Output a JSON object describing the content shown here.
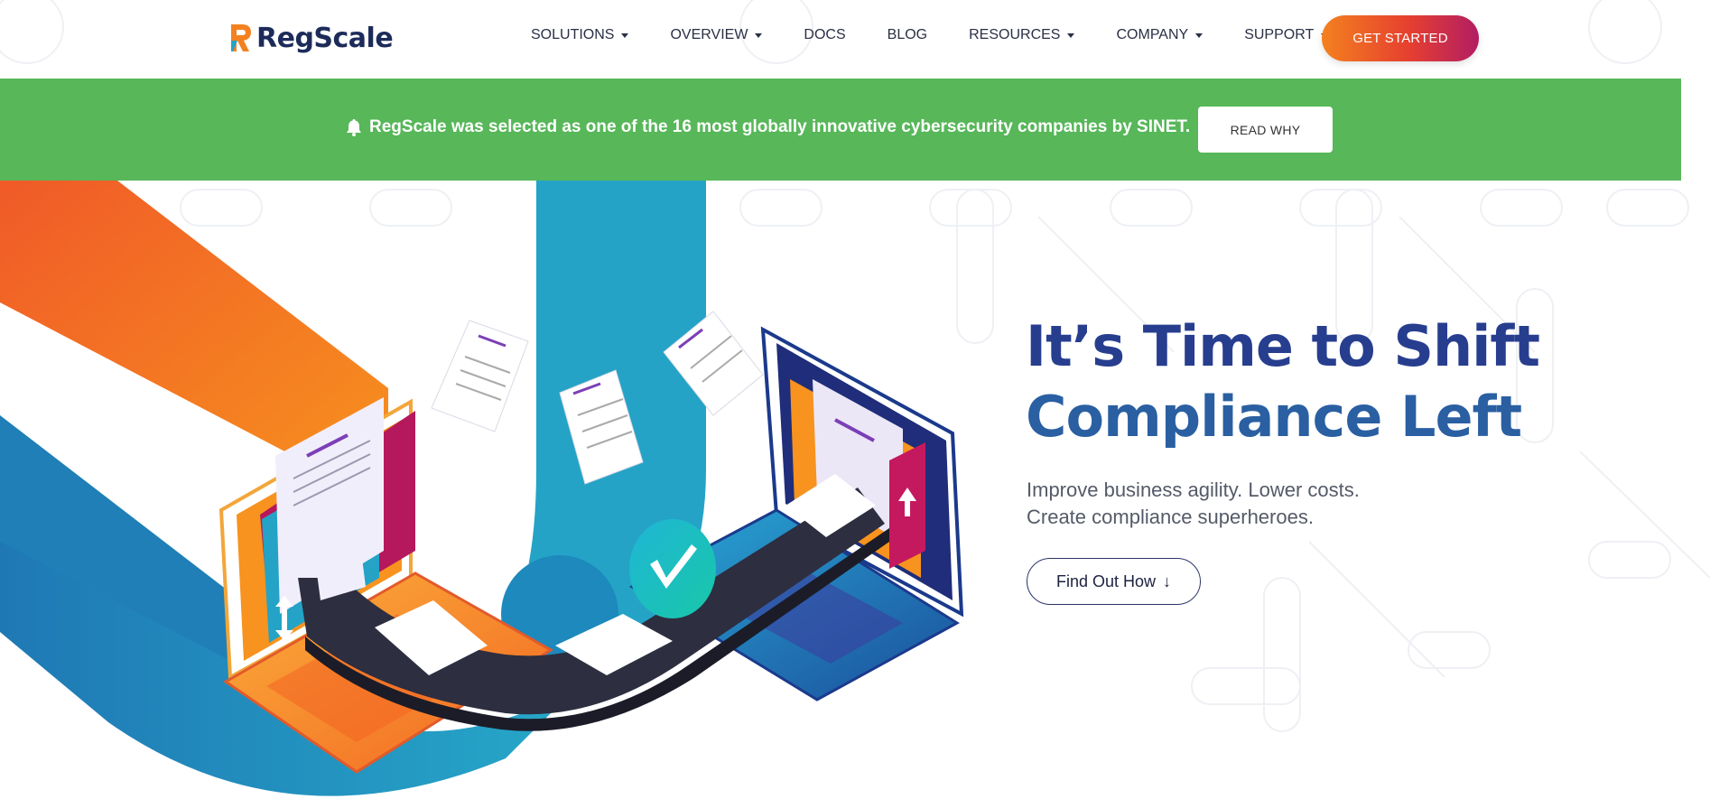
{
  "brand": {
    "name": "RegScale",
    "logo_icon": "regscale-logo-icon"
  },
  "nav": {
    "items": [
      {
        "label": "SOLUTIONS",
        "has_dropdown": true
      },
      {
        "label": "OVERVIEW",
        "has_dropdown": true
      },
      {
        "label": "DOCS",
        "has_dropdown": false
      },
      {
        "label": "BLOG",
        "has_dropdown": false
      },
      {
        "label": "RESOURCES",
        "has_dropdown": true
      },
      {
        "label": "COMPANY",
        "has_dropdown": true
      },
      {
        "label": "SUPPORT",
        "has_dropdown": true
      }
    ],
    "cta_label": "GET STARTED"
  },
  "banner": {
    "icon": "bell-icon",
    "text": "RegScale was selected as one of the 16 most globally innovative cybersecurity companies by SINET.",
    "button_label": "READ WHY",
    "background": "#57b759"
  },
  "hero": {
    "title_line1": "It’s Time to Shift",
    "title_line2": "Compliance Left",
    "subtitle_line1": "Improve business agility. Lower costs.",
    "subtitle_line2": "Create compliance superheroes.",
    "button_label": "Find Out How",
    "button_icon": "arrow-down-icon"
  },
  "colors": {
    "accent_orange": "#f4811f",
    "accent_magenta": "#b21d63",
    "brand_blue": "#273e8f",
    "teal": "#24a3c6",
    "banner_green": "#57b759"
  }
}
